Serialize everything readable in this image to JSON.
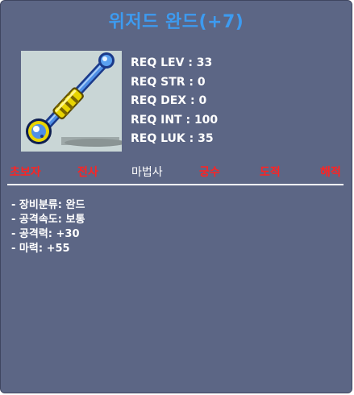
{
  "item": {
    "name": "위저드 완드(+7)",
    "icon": "wand-icon"
  },
  "requirements": [
    "REQ LEV : 33",
    "REQ STR : 0",
    "REQ DEX : 0",
    "REQ INT : 100",
    "REQ LUK : 35"
  ],
  "jobs": [
    {
      "label": "초보자",
      "allowed": false
    },
    {
      "label": "전사",
      "allowed": false
    },
    {
      "label": "마법사",
      "allowed": true
    },
    {
      "label": "궁수",
      "allowed": false
    },
    {
      "label": "도적",
      "allowed": false
    },
    {
      "label": "해적",
      "allowed": false
    }
  ],
  "stats": [
    "- 장비분류: 완드",
    "- 공격속도: 보통",
    "- 공격력: +30",
    "- 마력: +55"
  ],
  "colors": {
    "title": "#3d9bf0",
    "panel": "#5c6685",
    "job_disallowed": "#ff2323",
    "job_allowed": "#ffffff"
  }
}
